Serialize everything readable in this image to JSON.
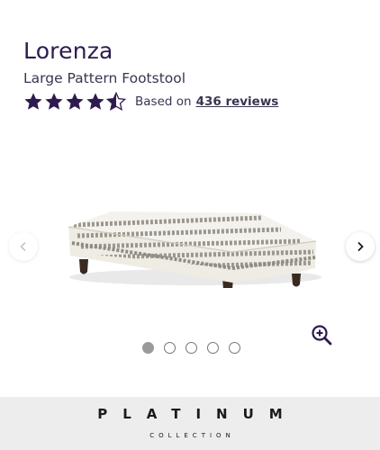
{
  "product": {
    "name": "Lorenza",
    "subtitle": "Large Pattern Footstool"
  },
  "rating": {
    "value": 4.5,
    "max": 5,
    "based_on_label": "Based on",
    "reviews_link": "436 reviews",
    "star_color": "#2e1a4f"
  },
  "gallery": {
    "slide_count": 5,
    "active_slide": 1,
    "prev_icon": "chevron-left-icon",
    "next_icon": "chevron-right-icon",
    "zoom_icon": "zoom-in-icon"
  },
  "banner": {
    "title": "PLATINUM",
    "subtitle": "COLLECTION"
  }
}
